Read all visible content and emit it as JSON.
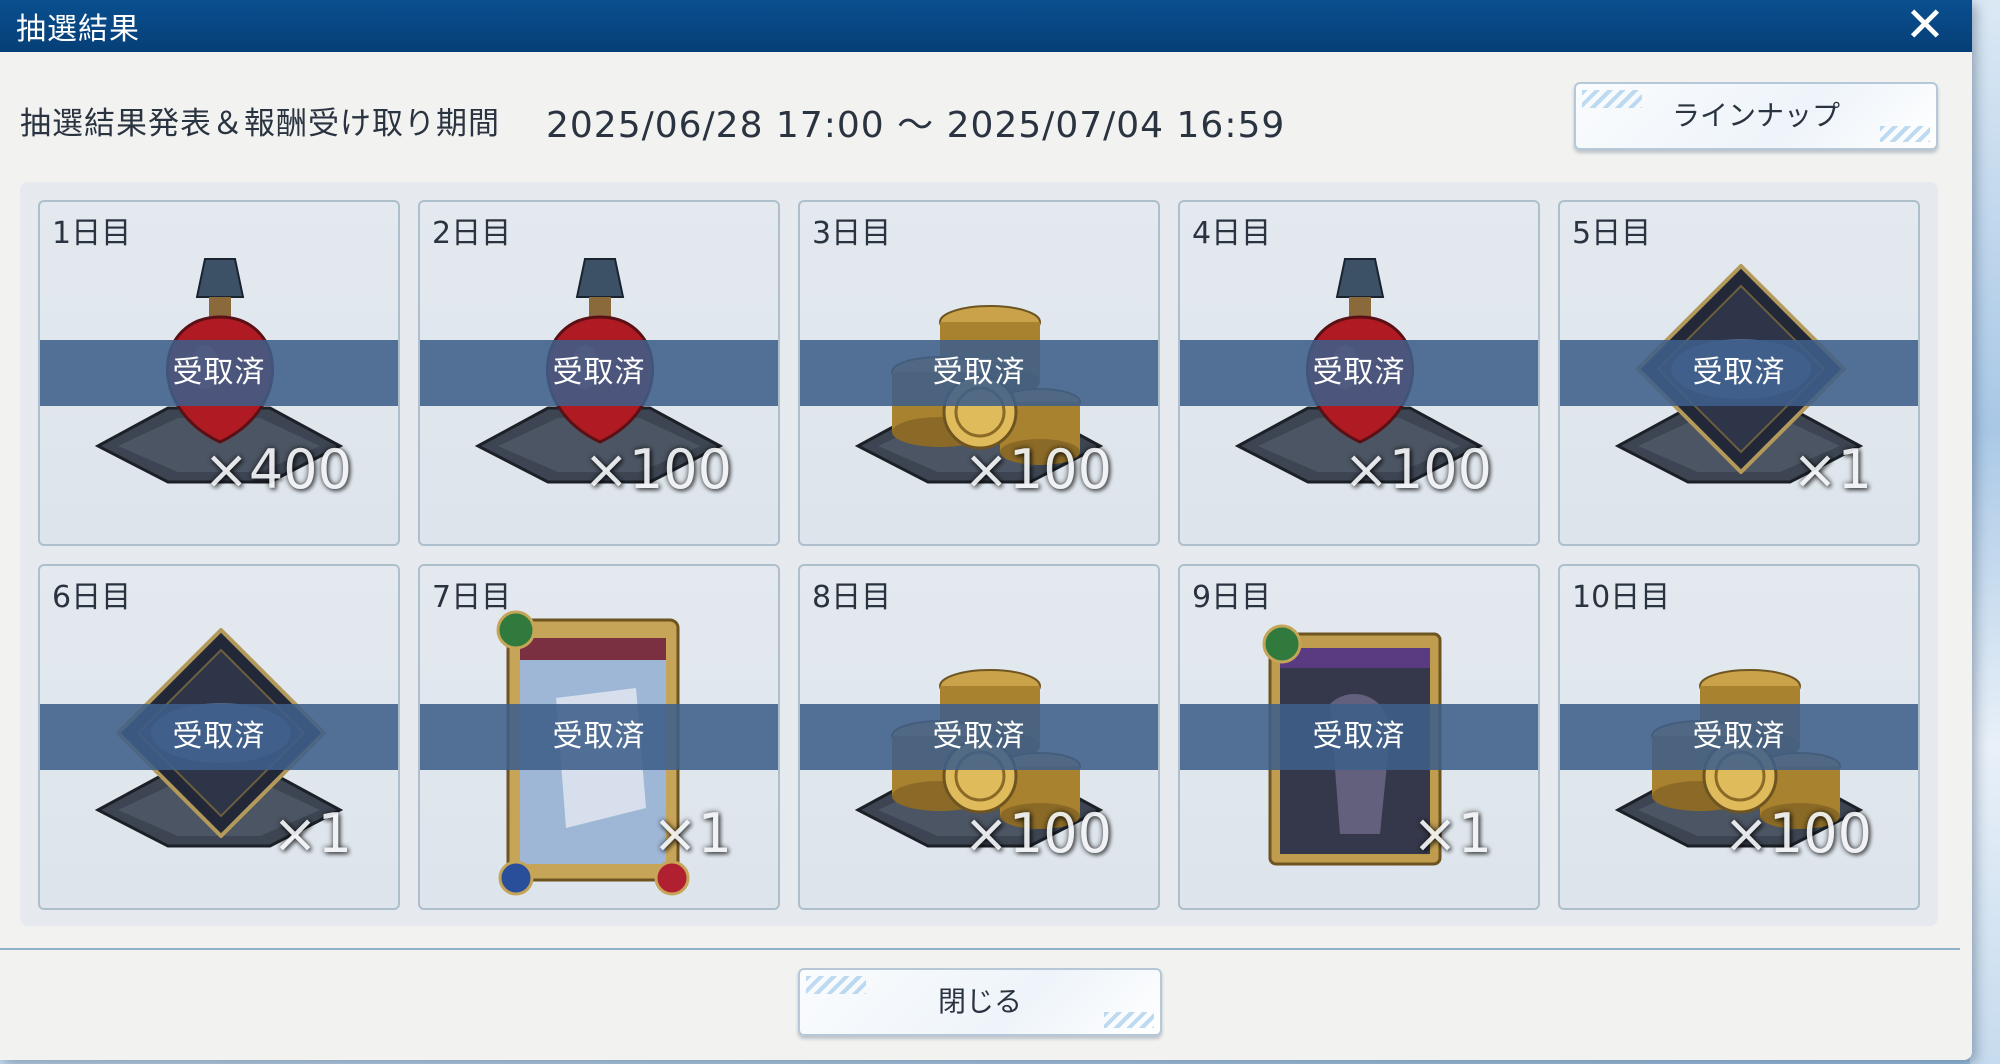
{
  "window": {
    "title": "抽選結果"
  },
  "header": {
    "period_label": "抽選結果発表＆報酬受け取り期間",
    "period_dates": "2025/06/28 17:00 ～ 2025/07/04 16:59",
    "lineup_button": "ラインナップ"
  },
  "rewards": [
    {
      "day": "1日目",
      "item": "potion-icon",
      "quantity": "×400",
      "status": "受取済"
    },
    {
      "day": "2日目",
      "item": "potion-icon",
      "quantity": "×100",
      "status": "受取済"
    },
    {
      "day": "3日目",
      "item": "coins-icon",
      "quantity": "×100",
      "status": "受取済"
    },
    {
      "day": "4日目",
      "item": "potion-icon",
      "quantity": "×100",
      "status": "受取済"
    },
    {
      "day": "5日目",
      "item": "card-pack-icon",
      "quantity": "×1",
      "status": "受取済"
    },
    {
      "day": "6日目",
      "item": "card-pack-icon",
      "quantity": "×1",
      "status": "受取済"
    },
    {
      "day": "7日目",
      "item": "card-icon",
      "quantity": "×1",
      "status": "受取済"
    },
    {
      "day": "8日目",
      "item": "coins-icon",
      "quantity": "×100",
      "status": "受取済"
    },
    {
      "day": "9日目",
      "item": "card-icon",
      "quantity": "×1",
      "status": "受取済"
    },
    {
      "day": "10日目",
      "item": "coins-icon",
      "quantity": "×100",
      "status": "受取済"
    }
  ],
  "footer": {
    "close_button": "閉じる"
  },
  "colors": {
    "titlebar": "#0a4f8f",
    "received_band": "#3e5e8a",
    "panel": "#f2f2f0"
  }
}
